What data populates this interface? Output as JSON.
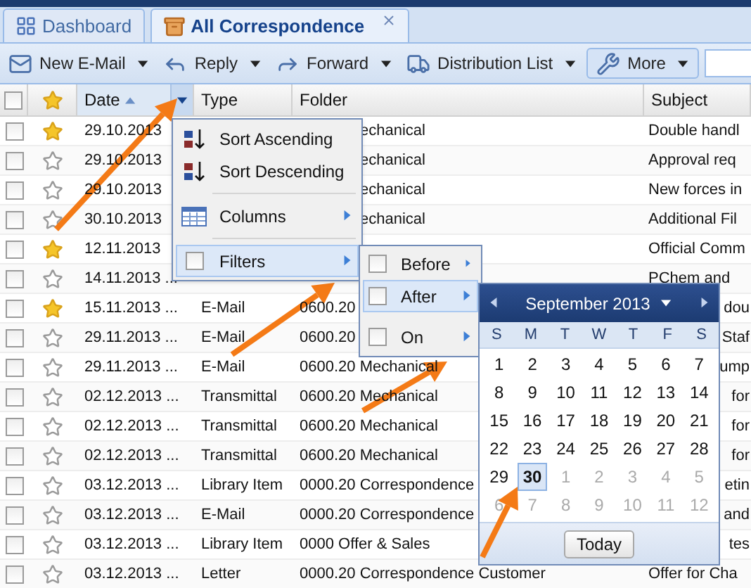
{
  "tabs": [
    {
      "label": "Dashboard",
      "selected": false,
      "closable": false
    },
    {
      "label": "All Correspondence",
      "selected": true,
      "closable": true
    }
  ],
  "toolbar": [
    {
      "label": "New E-Mail",
      "kind": "split"
    },
    {
      "label": "Reply",
      "kind": "split"
    },
    {
      "label": "Forward",
      "kind": "split"
    },
    {
      "label": "Distribution List",
      "kind": "split"
    },
    {
      "label": "More",
      "kind": "menu"
    }
  ],
  "header_checked": false,
  "columns": [
    {
      "label": "Date",
      "sorted": true
    },
    {
      "label": "Type",
      "sorted": false
    },
    {
      "label": "Folder",
      "sorted": false
    },
    {
      "label": "Subject",
      "sorted": false
    }
  ],
  "rows": [
    {
      "checked": false,
      "starred": true,
      "date": "29.10.2013",
      "folder": "echanical",
      "subject": "Double handl"
    },
    {
      "checked": false,
      "starred": false,
      "date": "29.10.2013",
      "folder": "echanical",
      "subject": "Approval req"
    },
    {
      "checked": false,
      "starred": false,
      "date": "29.10.2013",
      "folder": "echanical",
      "subject": "New forces in"
    },
    {
      "checked": false,
      "starred": false,
      "date": "30.10.2013",
      "folder": "echanical",
      "subject": "Additional Fil"
    },
    {
      "checked": false,
      "starred": true,
      "date": "12.11.2013",
      "subject": "Official Comm"
    },
    {
      "checked": false,
      "starred": false,
      "date": "14.11.2013 ...",
      "subject": "PChem and"
    },
    {
      "checked": false,
      "starred": true,
      "date": "15.11.2013 ...",
      "type": "E-Mail",
      "folder": "0600.20",
      "subject": "dou"
    },
    {
      "checked": false,
      "starred": false,
      "date": "29.11.2013 ...",
      "type": "E-Mail",
      "folder": "0600.20",
      "subject": "Staf"
    },
    {
      "checked": false,
      "starred": false,
      "date": "29.11.2013 ...",
      "type": "E-Mail",
      "folder": "0600.20 Mechanical",
      "subject": "ump"
    },
    {
      "checked": false,
      "starred": false,
      "date": "02.12.2013 ...",
      "type": "Transmittal",
      "folder": "0600.20 Mechanical",
      "subject": "for"
    },
    {
      "checked": false,
      "starred": false,
      "date": "02.12.2013 ...",
      "type": "Transmittal",
      "folder": "0600.20 Mechanical",
      "subject": "for"
    },
    {
      "checked": false,
      "starred": false,
      "date": "02.12.2013 ...",
      "type": "Transmittal",
      "folder": "0600.20 Mechanical",
      "subject": "for"
    },
    {
      "checked": false,
      "starred": false,
      "date": "03.12.2013 ...",
      "type": "Library Item",
      "folder": "0000.20 Correspondence",
      "subject": "etin"
    },
    {
      "checked": false,
      "starred": false,
      "date": "03.12.2013 ...",
      "type": "E-Mail",
      "folder": "0000.20 Correspondence",
      "subject": "and"
    },
    {
      "checked": false,
      "starred": false,
      "date": "03.12.2013 ...",
      "type": "Library Item",
      "folder": "0000 Offer & Sales",
      "subject": "tes"
    },
    {
      "checked": false,
      "starred": false,
      "date": "03.12.2013 ...",
      "type": "Letter",
      "folder": "0000.20 Correspondence Customer",
      "subject": "Offer for Cha"
    }
  ],
  "column_menu": [
    {
      "kind": "sort-asc",
      "label": "Sort Ascending",
      "selected": false
    },
    {
      "kind": "sort-desc",
      "label": "Sort Descending",
      "selected": false
    },
    {
      "kind": "separator"
    },
    {
      "kind": "columns",
      "label": "Columns",
      "selected": false
    },
    {
      "kind": "separator"
    },
    {
      "kind": "check",
      "label": "Filters",
      "checked": false,
      "selected": true
    }
  ],
  "filter_menu": [
    {
      "label": "Before",
      "checked": false,
      "selected": false
    },
    {
      "label": "After",
      "checked": false,
      "selected": true
    },
    {
      "label": "On",
      "checked": false,
      "selected": false
    }
  ],
  "calendar": {
    "month": "September 2013",
    "weekdays": [
      "S",
      "M",
      "T",
      "W",
      "T",
      "F",
      "S"
    ],
    "days": [
      {
        "day": "1",
        "muted": false,
        "selected": false
      },
      {
        "day": "2",
        "muted": false,
        "selected": false
      },
      {
        "day": "3",
        "muted": false,
        "selected": false
      },
      {
        "day": "4",
        "muted": false,
        "selected": false
      },
      {
        "day": "5",
        "muted": false,
        "selected": false
      },
      {
        "day": "6",
        "muted": false,
        "selected": false
      },
      {
        "day": "7",
        "muted": false,
        "selected": false
      },
      {
        "day": "8",
        "muted": false,
        "selected": false
      },
      {
        "day": "9",
        "muted": false,
        "selected": false
      },
      {
        "day": "10",
        "muted": false,
        "selected": false
      },
      {
        "day": "11",
        "muted": false,
        "selected": false
      },
      {
        "day": "12",
        "muted": false,
        "selected": false
      },
      {
        "day": "13",
        "muted": false,
        "selected": false
      },
      {
        "day": "14",
        "muted": false,
        "selected": false
      },
      {
        "day": "15",
        "muted": false,
        "selected": false
      },
      {
        "day": "16",
        "muted": false,
        "selected": false
      },
      {
        "day": "17",
        "muted": false,
        "selected": false
      },
      {
        "day": "18",
        "muted": false,
        "selected": false
      },
      {
        "day": "19",
        "muted": false,
        "selected": false
      },
      {
        "day": "20",
        "muted": false,
        "selected": false
      },
      {
        "day": "21",
        "muted": false,
        "selected": false
      },
      {
        "day": "22",
        "muted": false,
        "selected": false
      },
      {
        "day": "23",
        "muted": false,
        "selected": false
      },
      {
        "day": "24",
        "muted": false,
        "selected": false
      },
      {
        "day": "25",
        "muted": false,
        "selected": false
      },
      {
        "day": "26",
        "muted": false,
        "selected": false
      },
      {
        "day": "27",
        "muted": false,
        "selected": false
      },
      {
        "day": "28",
        "muted": false,
        "selected": false
      },
      {
        "day": "29",
        "muted": false,
        "selected": false
      },
      {
        "day": "30",
        "muted": false,
        "selected": true
      },
      {
        "day": "1",
        "muted": true,
        "selected": false
      },
      {
        "day": "2",
        "muted": true,
        "selected": false
      },
      {
        "day": "3",
        "muted": true,
        "selected": false
      },
      {
        "day": "4",
        "muted": true,
        "selected": false
      },
      {
        "day": "5",
        "muted": true,
        "selected": false
      },
      {
        "day": "6",
        "muted": true,
        "selected": false
      },
      {
        "day": "7",
        "muted": true,
        "selected": false
      },
      {
        "day": "8",
        "muted": true,
        "selected": false
      },
      {
        "day": "9",
        "muted": true,
        "selected": false
      },
      {
        "day": "10",
        "muted": true,
        "selected": false
      },
      {
        "day": "11",
        "muted": true,
        "selected": false
      },
      {
        "day": "12",
        "muted": true,
        "selected": false
      }
    ],
    "today_button": "Today"
  }
}
